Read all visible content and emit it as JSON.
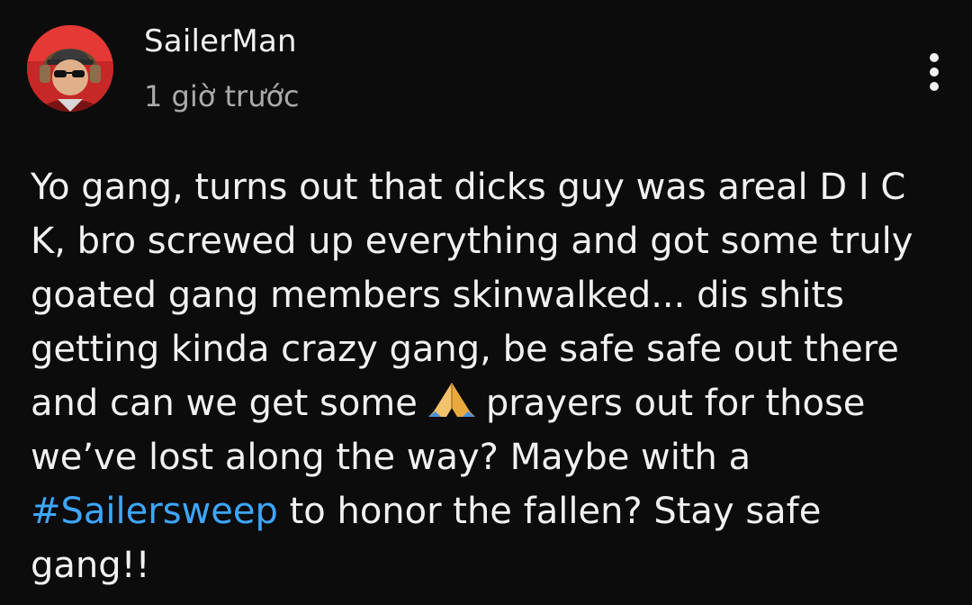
{
  "comment": {
    "author": "SailerMan",
    "timestamp": "1 giờ trước",
    "body_part1": "Yo gang, turns out that dicks guy was areal D I C K, bro screwed up everything and got some truly goated gang members skinwalked... dis shits getting kinda crazy gang, be safe safe out there and can we get some",
    "emoji": "folded-hands-emoji",
    "body_part2": "prayers out for those we’ve lost along the way? Maybe with a",
    "hashtag": "#Sailersweep",
    "body_part3": "to honor the fallen? Stay safe gang!!"
  },
  "colors": {
    "background": "#0c0c0c",
    "text": "#f1f1f1",
    "secondary_text": "#aaaaaa",
    "hashtag": "#3ea6ff",
    "avatar_bg": "#c62828"
  },
  "icons": {
    "avatar": "avatar-image",
    "menu": "more-vert-icon"
  }
}
